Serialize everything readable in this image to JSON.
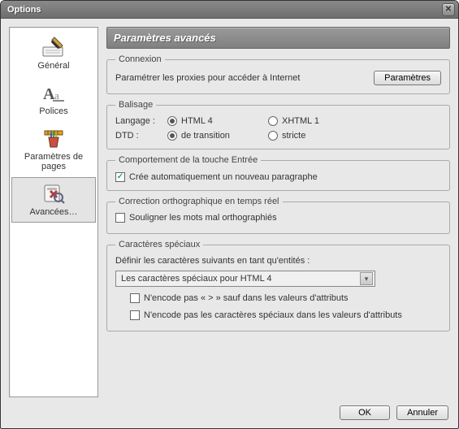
{
  "window": {
    "title": "Options"
  },
  "sidebar": {
    "items": [
      {
        "label": "Général"
      },
      {
        "label": "Polices"
      },
      {
        "label": "Paramètres de pages"
      },
      {
        "label": "Avancées…"
      }
    ]
  },
  "page": {
    "title": "Paramètres avancés"
  },
  "connexion": {
    "legend": "Connexion",
    "desc": "Paramétrer les proxies pour accéder à Internet",
    "button": "Paramètres"
  },
  "balisage": {
    "legend": "Balisage",
    "langLabel": "Langage :",
    "dtdLabel": "DTD :",
    "html4": "HTML 4",
    "xhtml1": "XHTML 1",
    "transition": "de transition",
    "stricte": "stricte"
  },
  "entree": {
    "legend": "Comportement de la touche Entrée",
    "opt": "Crée automatiquement un nouveau paragraphe"
  },
  "ortho": {
    "legend": "Correction orthographique en temps réel",
    "opt": "Souligner les mots mal orthographiés"
  },
  "chars": {
    "legend": "Caractères spéciaux",
    "desc": "Définir les caractères suivants en tant qu'entités :",
    "selectValue": "Les caractères spéciaux pour HTML 4",
    "opt1": "N'encode pas « > » sauf dans les valeurs d'attributs",
    "opt2": "N'encode pas les caractères spéciaux dans les valeurs d'attributs"
  },
  "footer": {
    "ok": "OK",
    "cancel": "Annuler"
  }
}
